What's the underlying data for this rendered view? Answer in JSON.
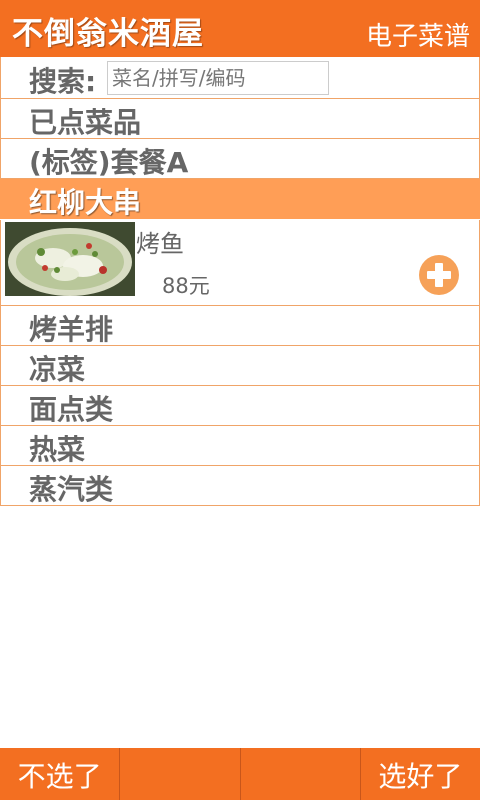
{
  "header": {
    "title": "不倒翁米酒屋",
    "subtitle": "电子菜谱"
  },
  "search": {
    "label": "搜索:",
    "placeholder": "菜名/拼写/编码"
  },
  "categories": [
    {
      "label": "已点菜品",
      "active": false
    },
    {
      "label": "(标签)套餐A",
      "active": false
    },
    {
      "label": "红柳大串",
      "active": true
    }
  ],
  "dish": {
    "name": "烤鱼",
    "price": "88元",
    "add_icon": "plus-circle-icon"
  },
  "categories_more": [
    {
      "label": "烤羊排"
    },
    {
      "label": "凉菜"
    },
    {
      "label": "面点类"
    },
    {
      "label": "热菜"
    },
    {
      "label": "蒸汽类"
    }
  ],
  "footer": {
    "cancel_label": "不选了",
    "empty_1": "",
    "empty_2": "",
    "confirm_label": "选好了"
  },
  "colors": {
    "brand": "#f36f21",
    "active_row": "#ff9e56",
    "border": "#f0a468",
    "text": "#666666"
  }
}
